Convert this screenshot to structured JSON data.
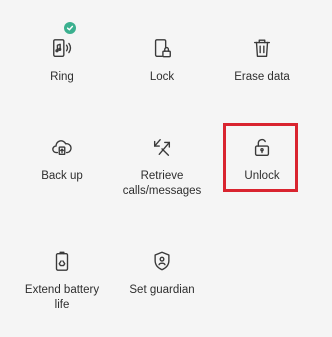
{
  "colors": {
    "background": "#f5f5f5",
    "icon": "#3a3a3a",
    "badge": "#3bb08f",
    "highlight": "#d9242f"
  },
  "tiles": [
    {
      "id": "ring",
      "label": "Ring",
      "icon": "phone-ring-icon",
      "badge": "check-icon"
    },
    {
      "id": "lock",
      "label": "Lock",
      "icon": "phone-lock-icon"
    },
    {
      "id": "erase",
      "label": "Erase data",
      "icon": "trash-icon"
    },
    {
      "id": "backup",
      "label": "Back up",
      "icon": "cloud-upload-icon"
    },
    {
      "id": "retrieve",
      "label": "Retrieve\ncalls/messages",
      "icon": "arrows-retrieve-icon"
    },
    {
      "id": "unlock",
      "label": "Unlock",
      "icon": "unlock-icon",
      "highlighted": true
    },
    {
      "id": "battery",
      "label": "Extend battery\nlife",
      "icon": "battery-recycle-icon"
    },
    {
      "id": "guardian",
      "label": "Set guardian",
      "icon": "shield-icon"
    }
  ]
}
